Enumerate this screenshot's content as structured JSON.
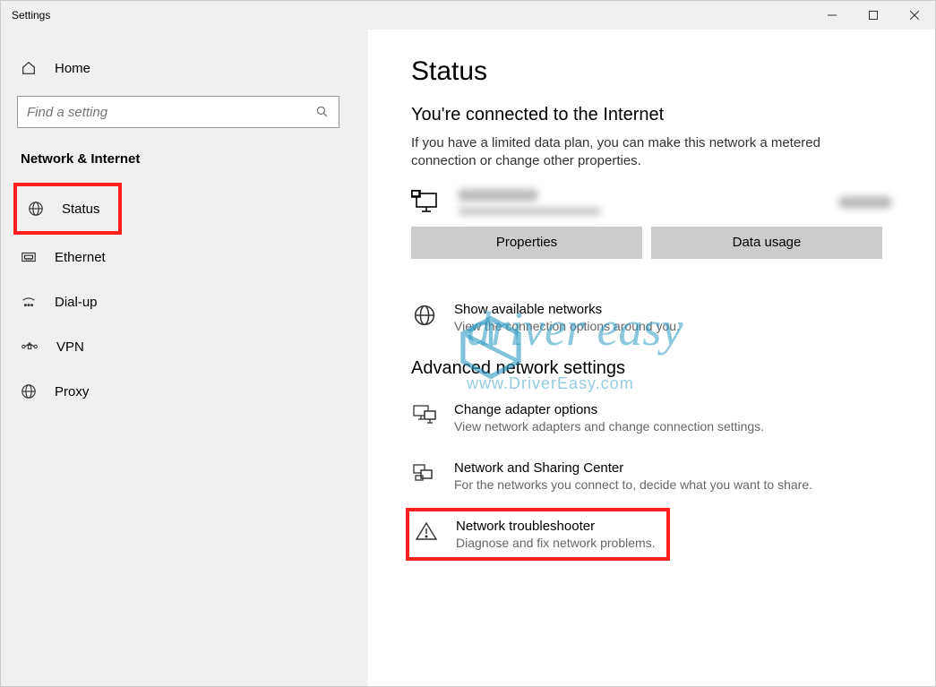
{
  "window": {
    "title": "Settings"
  },
  "sidebar": {
    "home_label": "Home",
    "search_placeholder": "Find a setting",
    "category": "Network & Internet",
    "items": [
      {
        "label": "Status",
        "icon": "globe-status-icon"
      },
      {
        "label": "Ethernet",
        "icon": "ethernet-icon"
      },
      {
        "label": "Dial-up",
        "icon": "dialup-icon"
      },
      {
        "label": "VPN",
        "icon": "vpn-icon"
      },
      {
        "label": "Proxy",
        "icon": "globe-icon"
      }
    ]
  },
  "main": {
    "title": "Status",
    "subtitle": "You're connected to the Internet",
    "description": "If you have a limited data plan, you can make this network a metered connection or change other properties.",
    "buttons": {
      "properties": "Properties",
      "data_usage": "Data usage"
    },
    "show_networks": {
      "title": "Show available networks",
      "desc": "View the connection options around you."
    },
    "advanced_title": "Advanced network settings",
    "adapter": {
      "title": "Change adapter options",
      "desc": "View network adapters and change connection settings."
    },
    "sharing": {
      "title": "Network and Sharing Center",
      "desc": "For the networks you connect to, decide what you want to share."
    },
    "troubleshoot": {
      "title": "Network troubleshooter",
      "desc": "Diagnose and fix network problems."
    }
  },
  "watermark": {
    "brand": "driver easy",
    "url": "www.DriverEasy.com"
  }
}
